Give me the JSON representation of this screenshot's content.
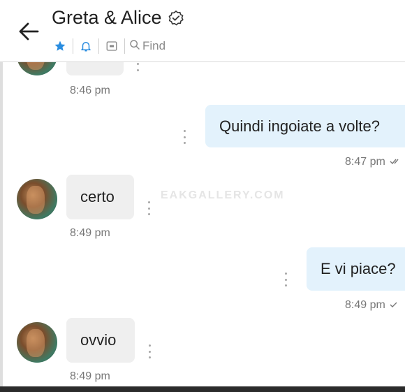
{
  "header": {
    "title": "Greta & Alice",
    "find_label": "Find",
    "star_color": "#2a8de0",
    "bell_color": "#2a8de0"
  },
  "messages": [
    {
      "side": "in",
      "text": "",
      "time": "8:46 pm"
    },
    {
      "side": "out",
      "text": "Quindi ingoiate a volte?",
      "time": "8:47 pm"
    },
    {
      "side": "in",
      "text": "certo",
      "time": "8:49 pm"
    },
    {
      "side": "out",
      "text": "E vi piace?",
      "time": "8:49 pm"
    },
    {
      "side": "in",
      "text": "ovvio",
      "time": "8:49 pm"
    }
  ],
  "watermark": "EAKGALLERY.COM",
  "colors": {
    "incoming_bubble": "#efefef",
    "outgoing_bubble": "#e3f2fc",
    "accent": "#2a8de0"
  }
}
